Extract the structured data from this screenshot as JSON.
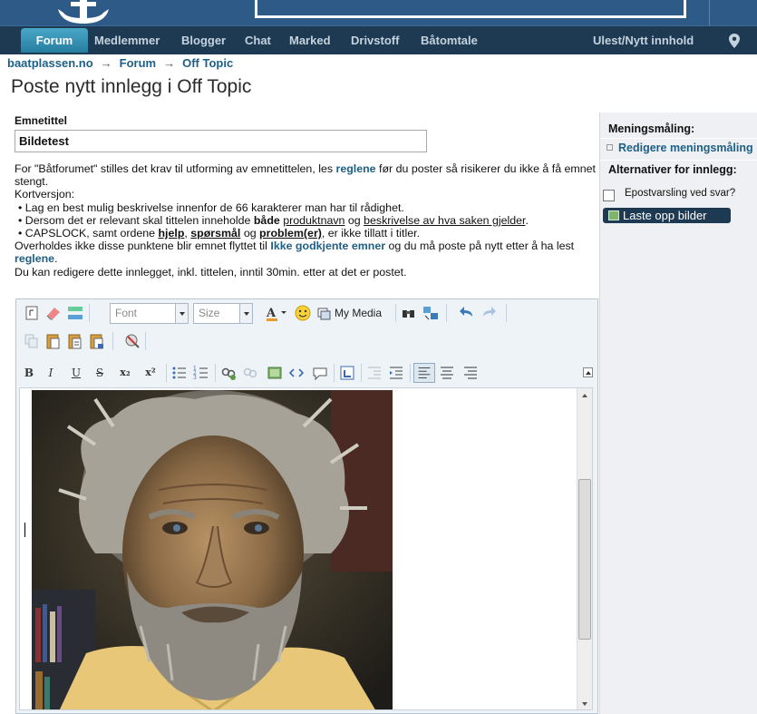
{
  "nav": {
    "active": "Forum",
    "items": [
      "Medlemmer",
      "Blogger",
      "Chat",
      "Marked",
      "Drivstoff",
      "Båtomtale"
    ],
    "right": "Ulest/Nytt innhold"
  },
  "breadcrumb": {
    "home": "baatplassen.no",
    "forum": "Forum",
    "current": "Off Topic",
    "sep": "→"
  },
  "page": {
    "title": "Poste nytt innlegg i Off Topic"
  },
  "form": {
    "subject_label": "Emnetittel",
    "subject_value": "Bildetest"
  },
  "rules": {
    "l1_pre": "For \"Båtforumet\" stilles det krav til utforming av emnetittelen, les ",
    "l1_link": "reglene",
    "l1_post": " før du poster så risikerer du ikke å få emnet stengt.",
    "l2": "Kortversjon:",
    "b1": "• Lag en best mulig beskrivelse innenfor de 66 karakterer man har til rådighet.",
    "b2_pre": "• Dersom det er relevant skal tittelen inneholde ",
    "b2_bold": "både",
    "b2_u1": "produktnavn",
    "b2_mid": " og ",
    "b2_u2": "beskrivelse av hva saken gjelder",
    "b2_end": ".",
    "b3_pre": "• CAPSLOCK, samt ordene ",
    "b3_w1": "hjelp",
    "b3_c1": ", ",
    "b3_w2": "spørsmål",
    "b3_c2": " og ",
    "b3_w3": "problem(er)",
    "b3_post": ", er ikke tillatt i titler.",
    "l4_pre": "Overholdes ikke disse punktene blir emnet flyttet til ",
    "l4_link": "Ikke godkjente emner",
    "l4_mid": " og du må poste på nytt etter å ha lest ",
    "l4_link2": "reglene",
    "l4_end": ".",
    "l5": "Du kan redigere dette innlegget, inkl. tittelen, inntil 30min. etter at det er postet."
  },
  "editor": {
    "font_placeholder": "Font",
    "size_placeholder": "Size",
    "mymedia_label": "My Media",
    "bold": "B",
    "italic": "I",
    "underline": "U",
    "strike": "S",
    "sub": "x₂",
    "sup": "x²"
  },
  "sidebar": {
    "poll_heading": "Meningsmåling:",
    "poll_link": "Redigere meningsmåling",
    "options_heading": "Alternativer for innlegg:",
    "notify_label": "Epostvarsling ved svar?",
    "upload_label": "Laste opp bilder"
  },
  "colors": {
    "nav_bg": "#1d3a52",
    "banner_bg": "#2d5a86",
    "link": "#1d5f86",
    "active_tab": "#267e9f"
  }
}
